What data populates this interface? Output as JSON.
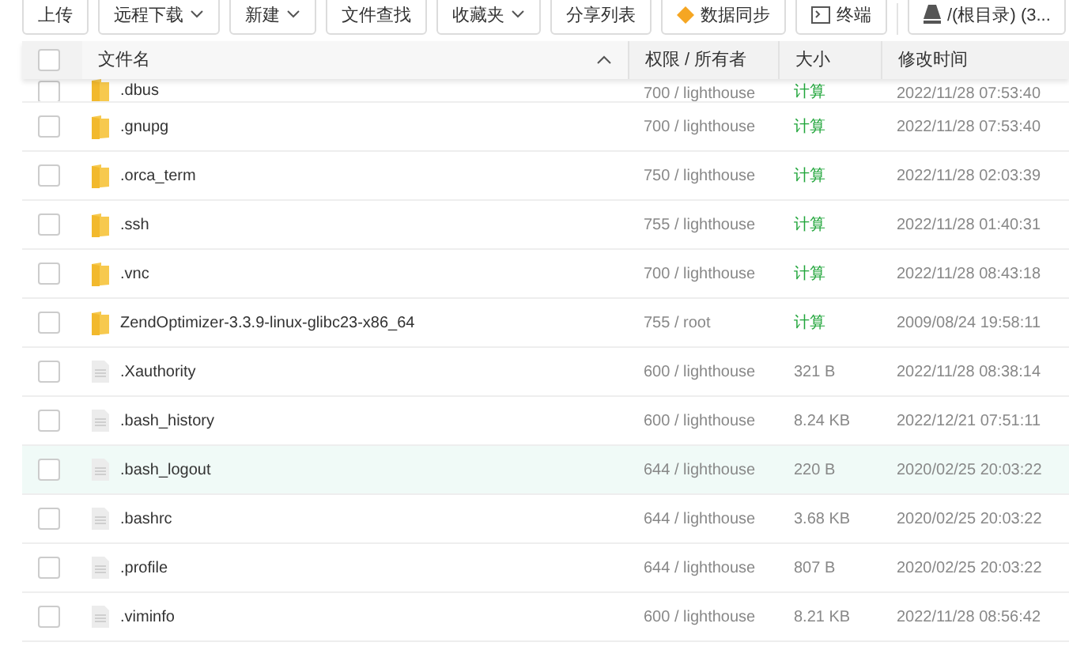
{
  "toolbar": [
    {
      "label": "上传",
      "kind": "plain"
    },
    {
      "label": "远程下载",
      "kind": "dropdown"
    },
    {
      "label": "新建",
      "kind": "dropdown"
    },
    {
      "label": "文件查找",
      "kind": "plain"
    },
    {
      "label": "收藏夹",
      "kind": "dropdown"
    },
    {
      "label": "分享列表",
      "kind": "plain"
    },
    {
      "label": "数据同步",
      "kind": "sync"
    },
    {
      "label": "终端",
      "kind": "terminal"
    },
    {
      "label": "/(根目录) (3...",
      "kind": "disk"
    }
  ],
  "table": {
    "checked": false,
    "columns": [
      "文件名",
      "权限 / 所有者",
      "大小",
      "修改时间"
    ],
    "rows": [
      {
        "kind": "folder",
        "name": ".dbus",
        "perm": "700 / lighthouse",
        "size": "计算",
        "time": "2022/11/28 07:53:40",
        "checked": false,
        "highlighted": false,
        "cut": true
      },
      {
        "kind": "folder",
        "name": ".gnupg",
        "perm": "700 / lighthouse",
        "size": "计算",
        "time": "2022/11/28 07:53:40",
        "checked": false,
        "highlighted": false,
        "cut": false
      },
      {
        "kind": "folder",
        "name": ".orca_term",
        "perm": "750 / lighthouse",
        "size": "计算",
        "time": "2022/11/28 02:03:39",
        "checked": false,
        "highlighted": false,
        "cut": false
      },
      {
        "kind": "folder",
        "name": ".ssh",
        "perm": "755 / lighthouse",
        "size": "计算",
        "time": "2022/11/28 01:40:31",
        "checked": false,
        "highlighted": false,
        "cut": false
      },
      {
        "kind": "folder",
        "name": ".vnc",
        "perm": "700 / lighthouse",
        "size": "计算",
        "time": "2022/11/28 08:43:18",
        "checked": false,
        "highlighted": false,
        "cut": false
      },
      {
        "kind": "folder",
        "name": "ZendOptimizer-3.3.9-linux-glibc23-x86_64",
        "perm": "755 / root",
        "size": "计算",
        "time": "2009/08/24 19:58:11",
        "checked": false,
        "highlighted": false,
        "cut": false
      },
      {
        "kind": "file",
        "name": ".Xauthority",
        "perm": "600 / lighthouse",
        "size": "321 B",
        "time": "2022/11/28 08:38:14",
        "checked": false,
        "highlighted": false,
        "cut": false
      },
      {
        "kind": "file",
        "name": ".bash_history",
        "perm": "600 / lighthouse",
        "size": "8.24 KB",
        "time": "2022/12/21 07:51:11",
        "checked": false,
        "highlighted": false,
        "cut": false
      },
      {
        "kind": "file",
        "name": ".bash_logout",
        "perm": "644 / lighthouse",
        "size": "220 B",
        "time": "2020/02/25 20:03:22",
        "checked": false,
        "highlighted": true,
        "cut": false
      },
      {
        "kind": "file",
        "name": ".bashrc",
        "perm": "644 / lighthouse",
        "size": "3.68 KB",
        "time": "2020/02/25 20:03:22",
        "checked": false,
        "highlighted": false,
        "cut": false
      },
      {
        "kind": "file",
        "name": ".profile",
        "perm": "644 / lighthouse",
        "size": "807 B",
        "time": "2020/02/25 20:03:22",
        "checked": false,
        "highlighted": false,
        "cut": false
      },
      {
        "kind": "file",
        "name": ".viminfo",
        "perm": "600 / lighthouse",
        "size": "8.21 KB",
        "time": "2022/11/28 08:56:42",
        "checked": false,
        "highlighted": false,
        "cut": false
      }
    ]
  }
}
